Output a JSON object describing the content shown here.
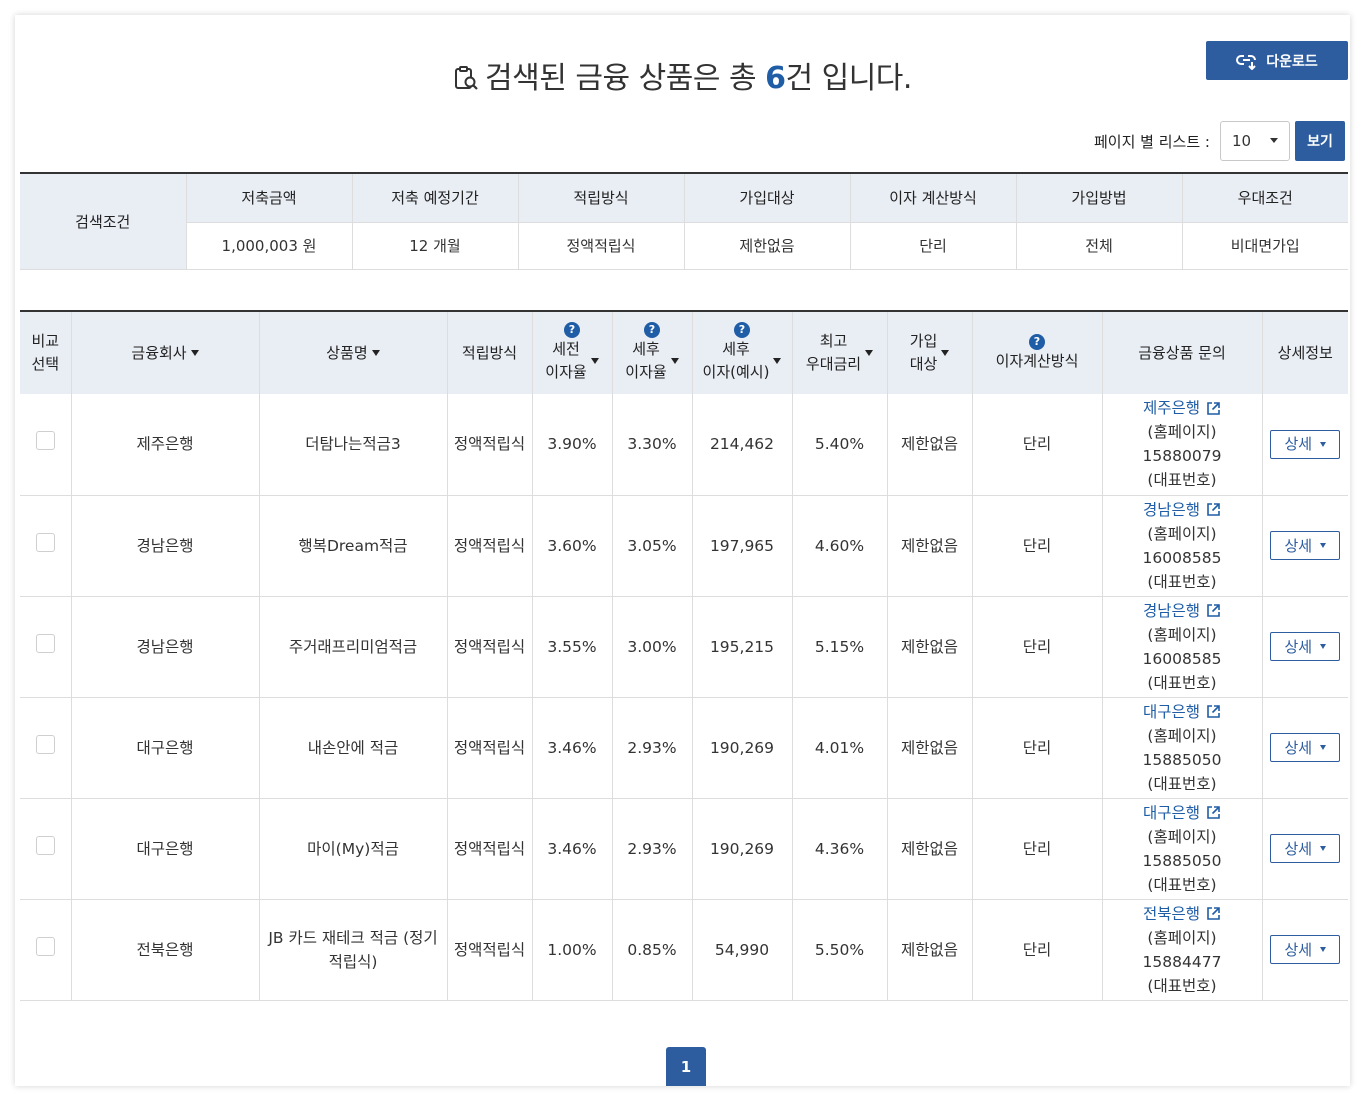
{
  "header": {
    "title_prefix": "검색된 금융 상품은 총 ",
    "title_count": "6",
    "title_suffix": "건 입니다.",
    "download_label": "다운로드"
  },
  "perpage": {
    "label": "페이지 별 리스트 :",
    "selected": "10",
    "view_label": "보기"
  },
  "conditions": {
    "label": "검색조건",
    "headers": [
      "저축금액",
      "저축 예정기간",
      "적립방식",
      "가입대상",
      "이자 계산방식",
      "가입방법",
      "우대조건"
    ],
    "values": [
      "1,000,003 원",
      "12 개월",
      "정액적립식",
      "제한없음",
      "단리",
      "전체",
      "비대면가입"
    ]
  },
  "results": {
    "headers": {
      "compare": [
        "비교",
        "선택"
      ],
      "company": "금융회사",
      "product": "상품명",
      "method": "적립방식",
      "pretax": [
        "세전",
        "이자율"
      ],
      "posttax": [
        "세후",
        "이자율"
      ],
      "interest": [
        "세후",
        "이자(예시)"
      ],
      "max_rate": [
        "최고",
        "우대금리"
      ],
      "target": [
        "가입",
        "대상"
      ],
      "calc": "이자계산방식",
      "inquiry": "금융상품 문의",
      "detail": "상세정보",
      "help_mark": "?"
    },
    "rows": [
      {
        "company": "제주은행",
        "product": "더탐나는적금3",
        "method": "정액적립식",
        "pretax": "3.90%",
        "posttax": "3.30%",
        "interest": "214,462",
        "max_rate": "5.40%",
        "target": "제한없음",
        "calc": "단리",
        "bank_link": "제주은행",
        "homepage": "(홈페이지)",
        "phone": "15880079",
        "phone_label": "(대표번호)",
        "detail": "상세"
      },
      {
        "company": "경남은행",
        "product": "행복Dream적금",
        "method": "정액적립식",
        "pretax": "3.60%",
        "posttax": "3.05%",
        "interest": "197,965",
        "max_rate": "4.60%",
        "target": "제한없음",
        "calc": "단리",
        "bank_link": "경남은행",
        "homepage": "(홈페이지)",
        "phone": "16008585",
        "phone_label": "(대표번호)",
        "detail": "상세"
      },
      {
        "company": "경남은행",
        "product": "주거래프리미엄적금",
        "method": "정액적립식",
        "pretax": "3.55%",
        "posttax": "3.00%",
        "interest": "195,215",
        "max_rate": "5.15%",
        "target": "제한없음",
        "calc": "단리",
        "bank_link": "경남은행",
        "homepage": "(홈페이지)",
        "phone": "16008585",
        "phone_label": "(대표번호)",
        "detail": "상세"
      },
      {
        "company": "대구은행",
        "product": "내손안에 적금",
        "method": "정액적립식",
        "pretax": "3.46%",
        "posttax": "2.93%",
        "interest": "190,269",
        "max_rate": "4.01%",
        "target": "제한없음",
        "calc": "단리",
        "bank_link": "대구은행",
        "homepage": "(홈페이지)",
        "phone": "15885050",
        "phone_label": "(대표번호)",
        "detail": "상세"
      },
      {
        "company": "대구은행",
        "product": "마이(My)적금",
        "method": "정액적립식",
        "pretax": "3.46%",
        "posttax": "2.93%",
        "interest": "190,269",
        "max_rate": "4.36%",
        "target": "제한없음",
        "calc": "단리",
        "bank_link": "대구은행",
        "homepage": "(홈페이지)",
        "phone": "15885050",
        "phone_label": "(대표번호)",
        "detail": "상세"
      },
      {
        "company": "전북은행",
        "product": "JB 카드 재테크 적금 (정기적립식)",
        "method": "정액적립식",
        "pretax": "1.00%",
        "posttax": "0.85%",
        "interest": "54,990",
        "max_rate": "5.50%",
        "target": "제한없음",
        "calc": "단리",
        "bank_link": "전북은행",
        "homepage": "(홈페이지)",
        "phone": "15884477",
        "phone_label": "(대표번호)",
        "detail": "상세"
      }
    ]
  },
  "pagination": {
    "current": "1"
  },
  "colors": {
    "accent": "#2d5d9f",
    "link": "#1f5da6",
    "header_bg": "#e9eef5"
  }
}
